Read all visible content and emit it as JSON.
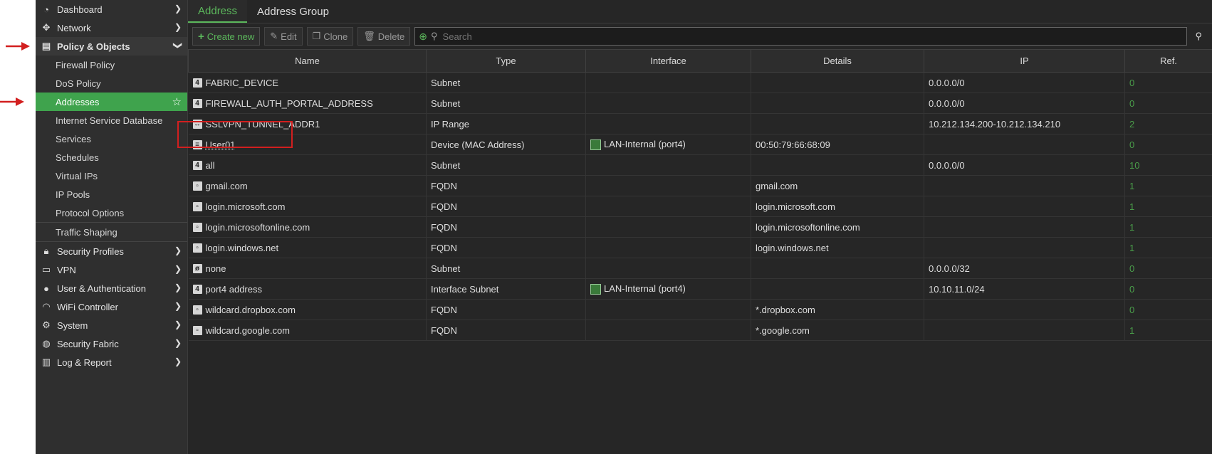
{
  "sidebar": {
    "items": [
      {
        "label": "Dashboard",
        "icon": "dashboard-icon"
      },
      {
        "label": "Network",
        "icon": "network-icon"
      },
      {
        "label": "Policy & Objects",
        "icon": "policy-icon"
      }
    ],
    "policy_sub": [
      "Firewall Policy",
      "DoS Policy",
      "Addresses",
      "Internet Service Database",
      "Services",
      "Schedules",
      "Virtual IPs",
      "IP Pools",
      "Protocol Options",
      "Traffic Shaping"
    ],
    "bottom": [
      {
        "label": "Security Profiles"
      },
      {
        "label": "VPN"
      },
      {
        "label": "User & Authentication"
      },
      {
        "label": "WiFi Controller"
      },
      {
        "label": "System"
      },
      {
        "label": "Security Fabric"
      },
      {
        "label": "Log & Report"
      }
    ]
  },
  "tabs": [
    "Address",
    "Address Group"
  ],
  "toolbar": {
    "create": "Create new",
    "edit": "Edit",
    "clone": "Clone",
    "delete": "Delete",
    "search_placeholder": "Search"
  },
  "table": {
    "headers": [
      "Name",
      "Type",
      "Interface",
      "Details",
      "IP",
      "Ref."
    ],
    "rows": [
      {
        "name": "FABRIC_DEVICE",
        "type": "Subnet",
        "interface": "",
        "details": "",
        "ip": "0.0.0.0/0",
        "ref": "0"
      },
      {
        "name": "FIREWALL_AUTH_PORTAL_ADDRESS",
        "type": "Subnet",
        "interface": "",
        "details": "",
        "ip": "0.0.0.0/0",
        "ref": "0"
      },
      {
        "name": "SSLVPN_TUNNEL_ADDR1",
        "type": "IP Range",
        "interface": "",
        "details": "",
        "ip": "10.212.134.200-10.212.134.210",
        "ref": "2"
      },
      {
        "name": "User01",
        "type": "Device (MAC Address)",
        "interface": "LAN-Internal (port4)",
        "details": "00:50:79:66:68:09",
        "ip": "",
        "ref": "0"
      },
      {
        "name": "all",
        "type": "Subnet",
        "interface": "",
        "details": "",
        "ip": "0.0.0.0/0",
        "ref": "10"
      },
      {
        "name": "gmail.com",
        "type": "FQDN",
        "interface": "",
        "details": "gmail.com",
        "ip": "",
        "ref": "1"
      },
      {
        "name": "login.microsoft.com",
        "type": "FQDN",
        "interface": "",
        "details": "login.microsoft.com",
        "ip": "",
        "ref": "1"
      },
      {
        "name": "login.microsoftonline.com",
        "type": "FQDN",
        "interface": "",
        "details": "login.microsoftonline.com",
        "ip": "",
        "ref": "1"
      },
      {
        "name": "login.windows.net",
        "type": "FQDN",
        "interface": "",
        "details": "login.windows.net",
        "ip": "",
        "ref": "1"
      },
      {
        "name": "none",
        "type": "Subnet",
        "interface": "",
        "details": "",
        "ip": "0.0.0.0/32",
        "ref": "0"
      },
      {
        "name": "port4 address",
        "type": "Interface Subnet",
        "interface": "LAN-Internal (port4)",
        "details": "",
        "ip": "10.10.11.0/24",
        "ref": "0"
      },
      {
        "name": "wildcard.dropbox.com",
        "type": "FQDN",
        "interface": "",
        "details": "*.dropbox.com",
        "ip": "",
        "ref": "0"
      },
      {
        "name": "wildcard.google.com",
        "type": "FQDN",
        "interface": "",
        "details": "*.google.com",
        "ip": "",
        "ref": "1"
      }
    ]
  },
  "colors": {
    "accent": "#5cb85c",
    "active_bg": "#3fa34d",
    "annotation": "#d21f1f"
  }
}
